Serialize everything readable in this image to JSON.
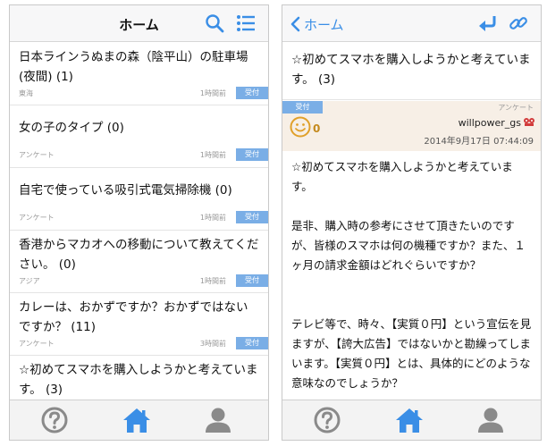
{
  "left": {
    "header": {
      "title": "ホーム"
    },
    "items": [
      {
        "title": "日本ラインうぬまの森（陰平山）の駐車場(夜間) (1)",
        "category": "東海",
        "time": "1時間前",
        "badge": "受付"
      },
      {
        "title": "女の子のタイプ (0)",
        "category": "アンケート",
        "time": "1時間前",
        "badge": "受付"
      },
      {
        "title": "自宅で使っている吸引式電気掃除機 (0)",
        "category": "アンケート",
        "time": "1時間前",
        "badge": "受付"
      },
      {
        "title": "香港からマカオへの移動について教えてください。 (0)",
        "category": "アジア",
        "time": "1時間前",
        "badge": "受付"
      },
      {
        "title": "カレーは、おかずですか？おかずではないですか？ (11)",
        "category": "アンケート",
        "time": "3時間前",
        "badge": "受付"
      },
      {
        "title": "☆初めてスマホを購入しようかと考えています。 (3)",
        "category": "",
        "time": "",
        "badge": ""
      }
    ]
  },
  "right": {
    "header": {
      "back_label": "ホーム"
    },
    "question_title": "☆初めてスマホを購入しようかと考えています。 (3)",
    "answer": {
      "badge": "受付",
      "category": "アンケート",
      "count": "0",
      "user": "willpower_gs",
      "date": "2014年9月17日 07:44:09"
    },
    "body": [
      "☆初めてスマホを購入しようかと考えています。",
      "是非、購入時の参考にさせて頂きたいのですが、皆様のスマホは何の機種ですか？また、１ヶ月の請求金額はどれぐらいですか？",
      "テレビ等で、時々、【実質０円】という宣伝を見ますが、【誇大広告】ではないかと勘繰ってしまいます。【実質０円】とは、具体的にどのような意味なのでしょうか？"
    ]
  },
  "colors": {
    "accent": "#3a8ee6",
    "badge": "#7aaee6",
    "answer_bg": "#f7efe6",
    "tab_inactive": "#8a8a8a"
  },
  "icons": [
    "search-icon",
    "list-icon",
    "back-chevron-icon",
    "reply-icon",
    "link-icon",
    "help-icon",
    "home-icon",
    "user-icon",
    "smiley-icon"
  ]
}
